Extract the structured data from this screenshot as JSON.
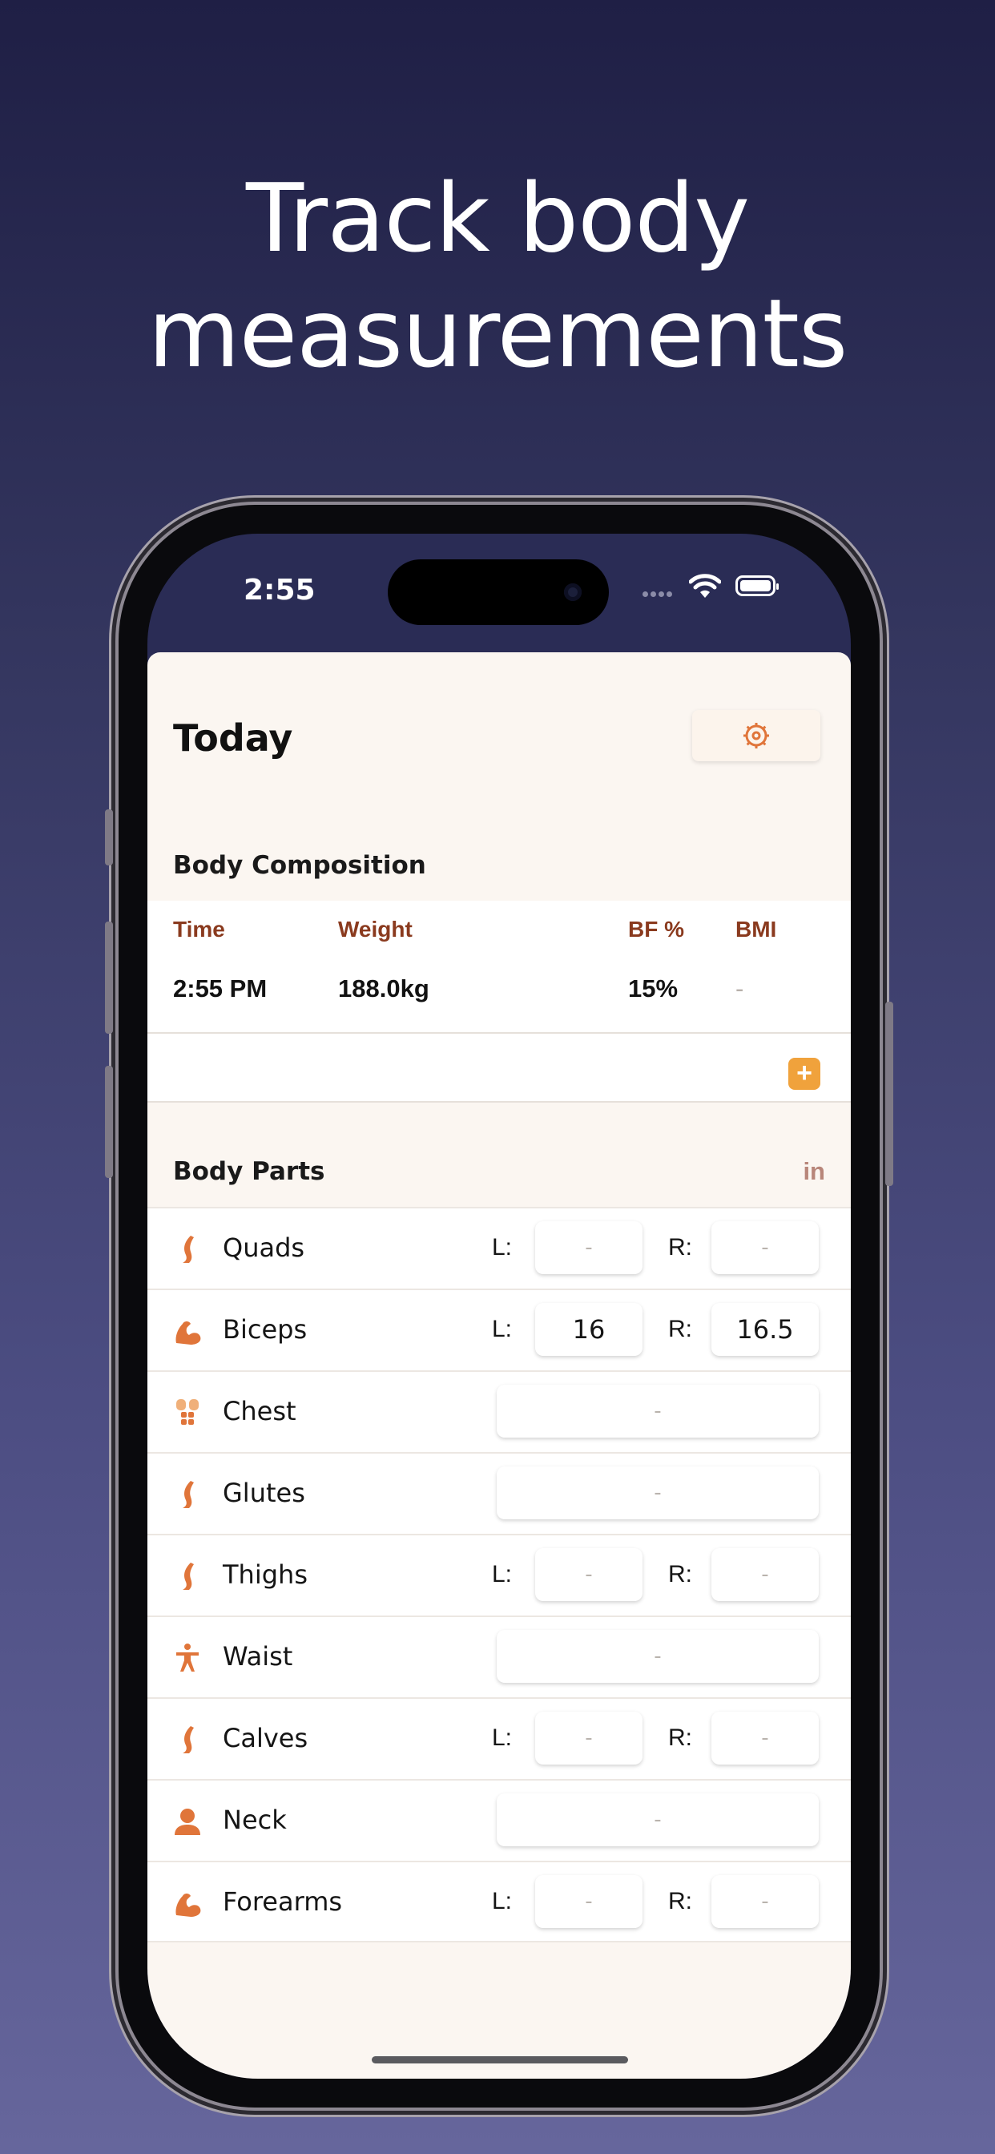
{
  "headline": {
    "line1": "Track body",
    "line2": "measurements"
  },
  "status_bar": {
    "time": "2:55"
  },
  "screen": {
    "title": "Today",
    "settings_icon": "gear-icon"
  },
  "body_composition": {
    "section_title": "Body Composition",
    "columns": [
      "Time",
      "Weight",
      "BF %",
      "BMI"
    ],
    "row": {
      "time": "2:55 PM",
      "weight": "188.0kg",
      "bf": "15%",
      "bmi": "-"
    },
    "add_label": "+"
  },
  "body_parts": {
    "section_title": "Body Parts",
    "unit": "in",
    "left_label": "L:",
    "right_label": "R:",
    "items": [
      {
        "name": "Quads",
        "icon": "leg-icon",
        "paired": true,
        "left": "-",
        "right": "-"
      },
      {
        "name": "Biceps",
        "icon": "flexed-arm-icon",
        "paired": true,
        "left": "16",
        "right": "16.5"
      },
      {
        "name": "Chest",
        "icon": "torso-icon",
        "paired": false,
        "value": "-"
      },
      {
        "name": "Glutes",
        "icon": "leg-icon",
        "paired": false,
        "value": "-"
      },
      {
        "name": "Thighs",
        "icon": "leg-icon",
        "paired": true,
        "left": "-",
        "right": "-"
      },
      {
        "name": "Waist",
        "icon": "figure-icon",
        "paired": false,
        "value": "-"
      },
      {
        "name": "Calves",
        "icon": "leg-icon",
        "paired": true,
        "left": "-",
        "right": "-"
      },
      {
        "name": "Neck",
        "icon": "person-bust-icon",
        "paired": false,
        "value": "-"
      },
      {
        "name": "Forearms",
        "icon": "flexed-arm-icon",
        "paired": true,
        "left": "-",
        "right": "-"
      }
    ]
  },
  "colors": {
    "accent": "#e0753a",
    "header_text": "#8a3a1e",
    "add_button": "#f0a23c",
    "sheet_bg": "#fbf6f1"
  }
}
